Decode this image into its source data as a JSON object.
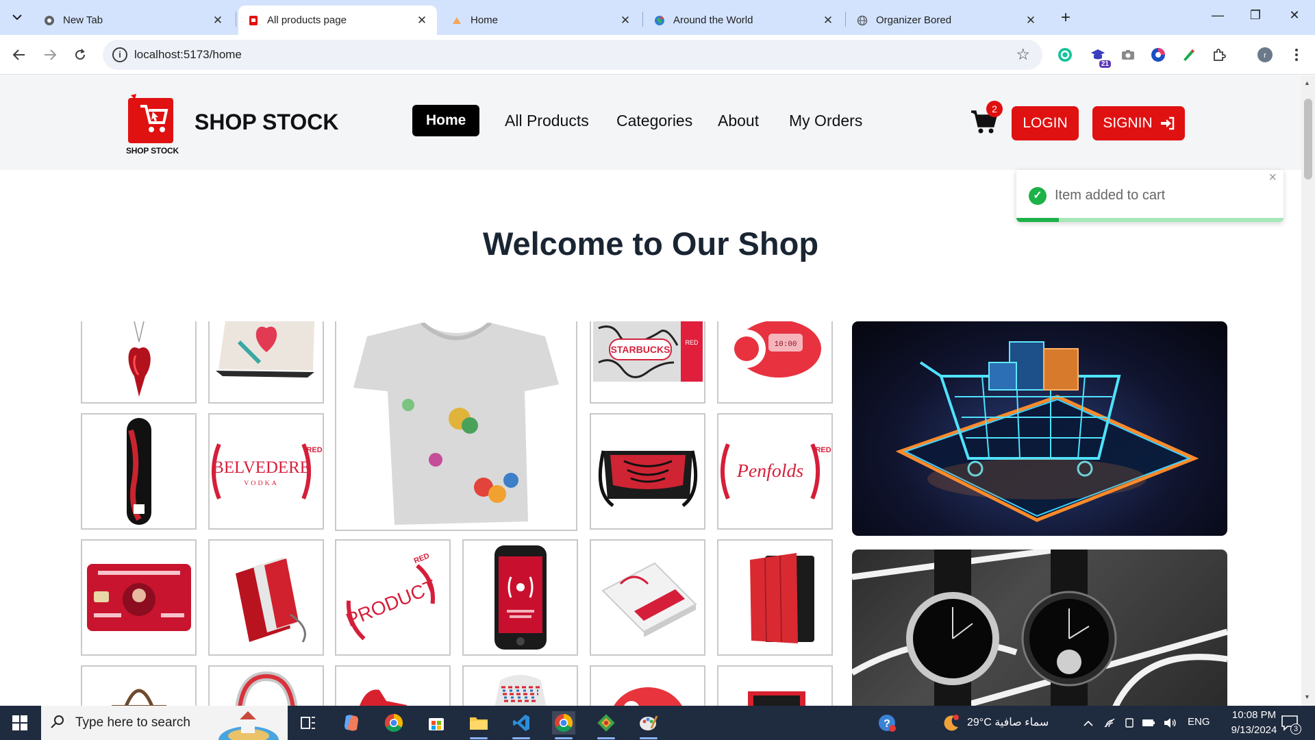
{
  "browser": {
    "tabs": [
      {
        "title": "New Tab",
        "active": false
      },
      {
        "title": "All products page",
        "active": true
      },
      {
        "title": "Home",
        "active": false
      },
      {
        "title": "Around the World",
        "active": false
      },
      {
        "title": "Organizer Bored",
        "active": false
      }
    ],
    "url": "localhost:5173/home",
    "extension_badge": "21"
  },
  "header": {
    "logo_text": "SHOP STOCK",
    "brand": "SHOP STOCK",
    "nav": [
      {
        "label": "Home",
        "active": true
      },
      {
        "label": "All Products",
        "active": false
      },
      {
        "label": "Categories",
        "active": false
      },
      {
        "label": "About",
        "active": false
      },
      {
        "label": "My Orders",
        "active": false
      }
    ],
    "cart_count": "2",
    "login_label": "LOGIN",
    "signin_label": "SIGNIN"
  },
  "toast": {
    "message": "Item added to cart",
    "progress": 0.16,
    "close": "×"
  },
  "main": {
    "heading": "Welcome to Our Shop",
    "product_tiles": [
      {
        "name": "heart-pendant"
      },
      {
        "name": "laptop-skin"
      },
      {
        "name": "tshirt"
      },
      {
        "name": "starbucks-card"
      },
      {
        "name": "alarm-clock"
      },
      {
        "name": "skateboard"
      },
      {
        "name": "belvedere-vodka"
      },
      {
        "name": "messenger-bag"
      },
      {
        "name": "penfolds"
      },
      {
        "name": "amex-card"
      },
      {
        "name": "red-cases"
      },
      {
        "name": "product-red-logo"
      },
      {
        "name": "iphone"
      },
      {
        "name": "book-box"
      },
      {
        "name": "ipad-cover"
      }
    ],
    "tile_text": {
      "starbucks": "STARBUCKS",
      "red": "RED",
      "belvedere": "BELVEDERE",
      "vodka": "VODKA",
      "penfolds": "Penfolds",
      "product": "PRODUCT"
    }
  },
  "taskbar": {
    "search_placeholder": "Type here to search",
    "weather": "29°C  سماء صافية",
    "language": "ENG",
    "time": "10:08 PM",
    "date": "9/13/2024",
    "notifications": "3"
  },
  "colors": {
    "brand_red": "#e01111",
    "toast_green": "#1db248",
    "tab_strip": "#d3e3fd"
  }
}
